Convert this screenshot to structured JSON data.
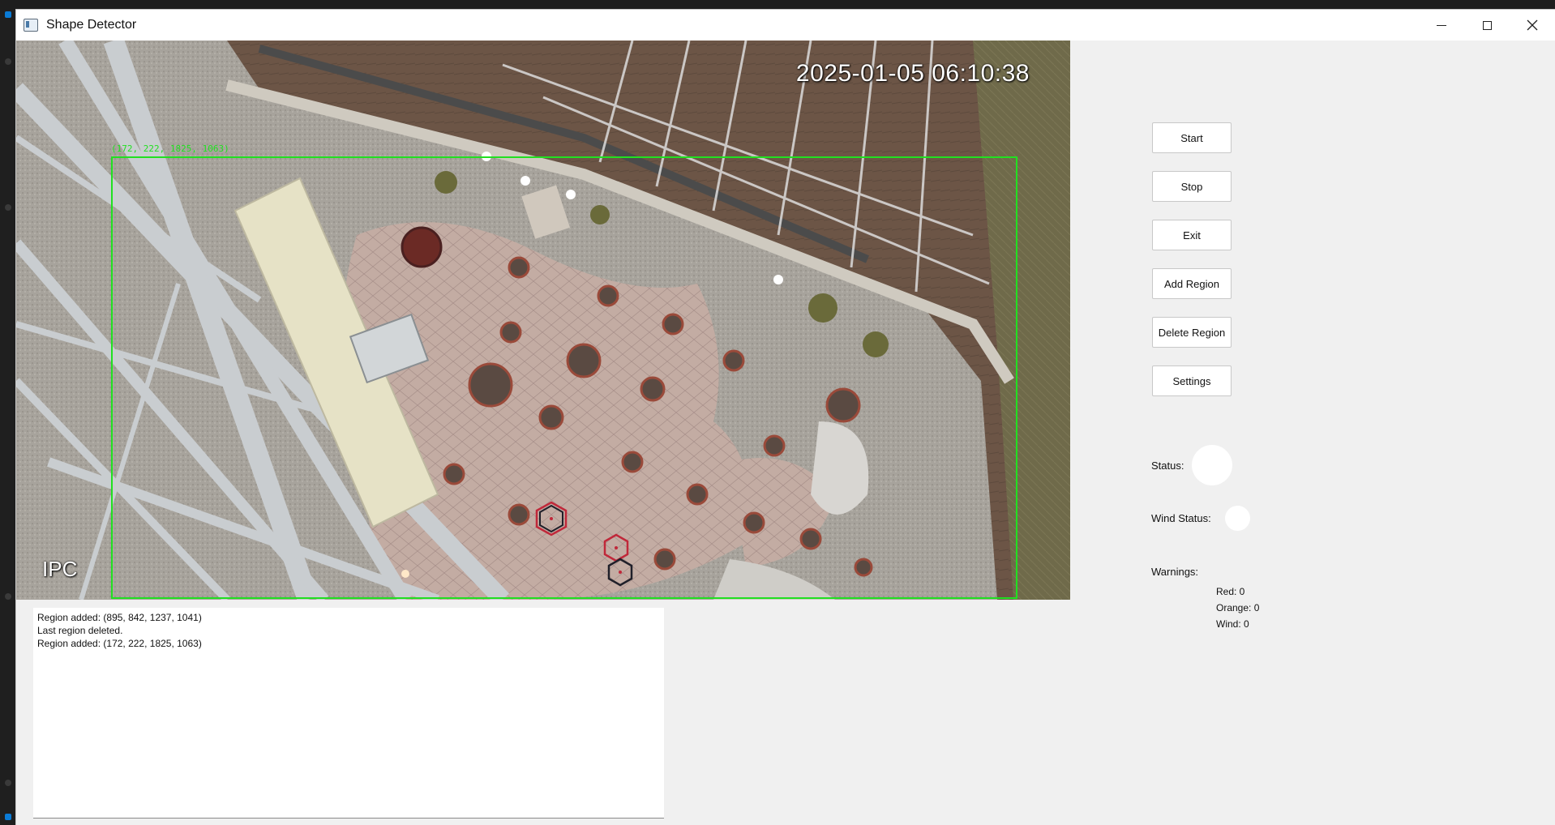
{
  "window": {
    "title": "Shape Detector"
  },
  "feed": {
    "timestamp": "2025-01-05 06:10:38",
    "camera_label": "IPC",
    "roi_label": "(172, 222, 1825, 1063)"
  },
  "log": {
    "lines": [
      "Region added: (895, 842, 1237, 1041)",
      "Last region deleted.",
      "Region added: (172, 222, 1825, 1063)"
    ]
  },
  "controls": {
    "start_label": "Start",
    "stop_label": "Stop",
    "exit_label": "Exit",
    "add_region_label": "Add Region",
    "delete_region_label": "Delete Region",
    "settings_label": "Settings"
  },
  "status": {
    "status_label": "Status:",
    "wind_status_label": "Wind Status:",
    "status_color": "#ffffff",
    "wind_color": "#ffffff"
  },
  "warnings": {
    "title": "Warnings:",
    "red": "Red: 0",
    "orange": "Orange: 0",
    "wind": "Wind: 0"
  },
  "colors": {
    "roi_border": "#21e021",
    "window_bg": "#f0f0f0"
  }
}
